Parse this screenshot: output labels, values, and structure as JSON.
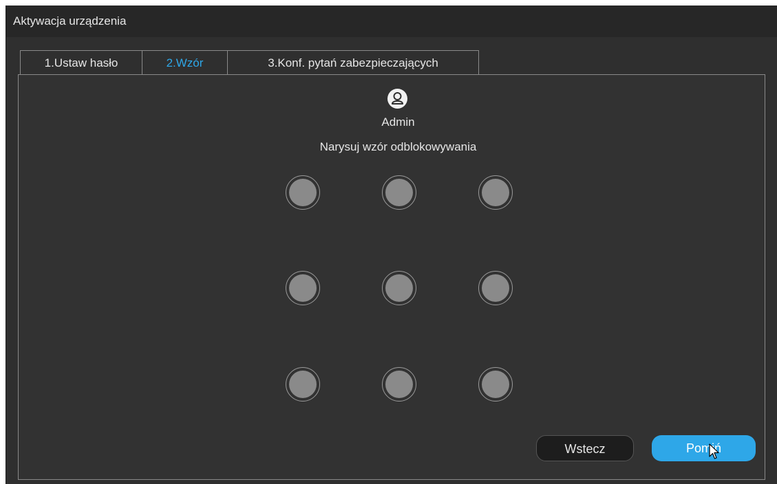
{
  "window": {
    "title": "Aktywacja urządzenia"
  },
  "tabs": [
    {
      "label": "1.Ustaw hasło",
      "active": false
    },
    {
      "label": "2.Wzór",
      "active": true
    },
    {
      "label": "3.Konf. pytań zabezpieczających",
      "active": false
    }
  ],
  "user": {
    "name": "Admin",
    "icon": "user-avatar-icon"
  },
  "pattern": {
    "instruction": "Narysuj wzór odblokowywania",
    "rows": 3,
    "cols": 3
  },
  "buttons": {
    "back_label": "Wstecz",
    "skip_label": "Pomiń"
  },
  "colors": {
    "accent": "#2ea7e8",
    "background": "#2f2f2f",
    "dot": "#8a8a8a"
  }
}
